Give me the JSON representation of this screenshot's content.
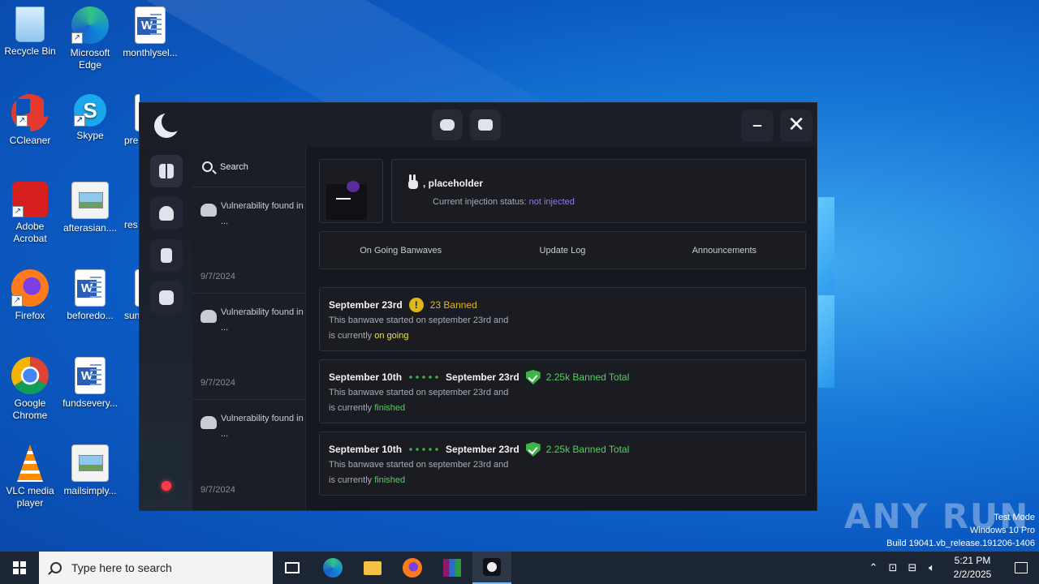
{
  "desktop": {
    "icons": [
      {
        "label": "Recycle Bin"
      },
      {
        "label": "Microsoft Edge"
      },
      {
        "label": "monthlysel..."
      },
      {
        "label": "CCleaner"
      },
      {
        "label": "Skype"
      },
      {
        "label": "pre"
      },
      {
        "label": "Adobe Acrobat"
      },
      {
        "label": "afterasian...."
      },
      {
        "label": "res"
      },
      {
        "label": "Firefox"
      },
      {
        "label": "beforedo..."
      },
      {
        "label": "sun"
      },
      {
        "label": "Google Chrome"
      },
      {
        "label": "fundsevery..."
      },
      {
        "label": "VLC media player"
      },
      {
        "label": "mailsimply..."
      }
    ]
  },
  "app": {
    "search_label": "Search",
    "feed": [
      {
        "title": "Vulnerability found in ...",
        "date": "9/7/2024"
      },
      {
        "title": "Vulnerability found in ...",
        "date": "9/7/2024"
      },
      {
        "title": "Vulnerability found in ...",
        "date": "9/7/2024"
      }
    ],
    "profile": {
      "greeting": ", placeholder",
      "status_label": "Current injection status:",
      "status_value": "not injected"
    },
    "tabs": [
      "On Going Banwaves",
      "Update Log",
      "Announcements"
    ],
    "banwaves": [
      {
        "start": "September 23rd",
        "end": "",
        "count": "23 Banned",
        "desc": "This banwave started on september 23rd and",
        "status_prefix": "is currently",
        "status": "on going"
      },
      {
        "start": "September 10th",
        "end": "September 23rd",
        "count": "2.25k Banned Total",
        "desc": "This banwave started on september 23rd and",
        "status_prefix": "is currently",
        "status": "finished"
      },
      {
        "start": "September 10th",
        "end": "September 23rd",
        "count": "2.25k Banned Total",
        "desc": "This banwave started on september 23rd and",
        "status_prefix": "is currently",
        "status": "finished"
      }
    ]
  },
  "watermark": {
    "brand": "ANY RUN",
    "line1": "Test Mode",
    "line2": "Windows 10 Pro",
    "line3": "Build 19041.vb_release.191206-1406"
  },
  "taskbar": {
    "search_placeholder": "Type here to search",
    "time": "5:21 PM",
    "date": "2/2/2025"
  }
}
